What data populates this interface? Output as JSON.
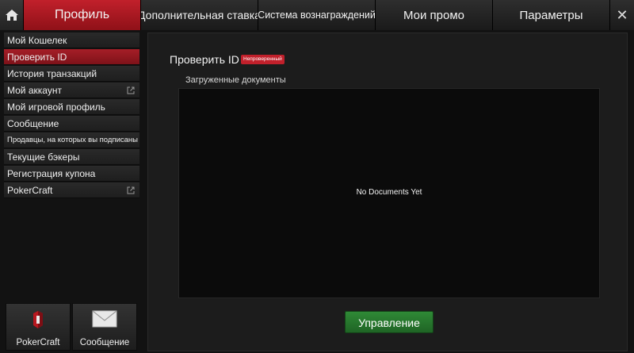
{
  "tabs": {
    "profile": "Профиль",
    "extra_bet": "Дополнительная ставка",
    "rewards": "Система вознаграждений",
    "promos": "Мои промо",
    "settings": "Параметры",
    "close": "✕"
  },
  "sidebar": {
    "items": [
      {
        "label": "Мой Кошелек"
      },
      {
        "label": "Проверить ID"
      },
      {
        "label": "История транзакций"
      },
      {
        "label": "Мой аккаунт"
      },
      {
        "label": "Мой игровой профиль"
      },
      {
        "label": "Сообщение"
      },
      {
        "label": "Продавцы, на которых вы подписаны"
      },
      {
        "label": "Текущие бэкеры"
      },
      {
        "label": "Регистрация купона"
      },
      {
        "label": "PokerCraft"
      }
    ]
  },
  "shortcuts": {
    "pokercraft": "PokerCraft",
    "message": "Сообщение"
  },
  "main": {
    "title": "Проверить ID",
    "status_badge": "Непроверенный",
    "docs_label": "Загруженные документы",
    "docs_empty": "No Documents Yet",
    "manage_button": "Управление"
  },
  "colors": {
    "accent_red": "#c1202b",
    "button_green": "#2f8a36"
  },
  "icons": [
    "home-icon",
    "close-icon",
    "external-link-icon",
    "pokercraft-icon",
    "envelope-icon"
  ]
}
